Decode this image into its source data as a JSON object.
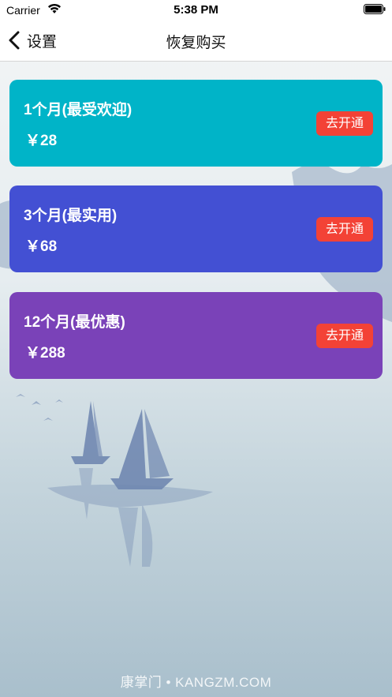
{
  "status_bar": {
    "carrier": "Carrier",
    "time": "5:38 PM"
  },
  "nav": {
    "back_label": "设置",
    "title": "恢复购买"
  },
  "plans": [
    {
      "name": "1个月(最受欢迎)",
      "price": "￥28",
      "button": "去开通",
      "color": "#00b4c8"
    },
    {
      "name": "3个月(最实用)",
      "price": "￥68",
      "button": "去开通",
      "color": "#4350d3"
    },
    {
      "name": "12个月(最优惠)",
      "price": "￥288",
      "button": "去开通",
      "color": "#7a42b8"
    }
  ],
  "watermark": "康掌门 • KANGZM.COM",
  "colors": {
    "button_red": "#f34236",
    "ink_blue": "#6e86b0"
  }
}
